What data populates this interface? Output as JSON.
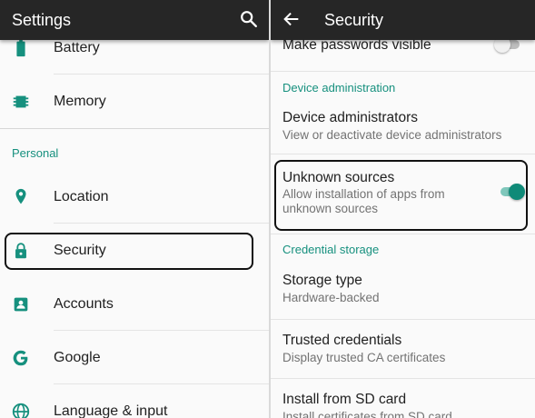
{
  "colors": {
    "accent": "#16907e",
    "appbar": "#262626",
    "toggle_on_thumb": "#0f8a78",
    "toggle_on_track": "#7fc7bb"
  },
  "left": {
    "title": "Settings",
    "search_icon": "search-icon",
    "items_top": [
      {
        "label": "Battery",
        "icon": "battery-icon"
      },
      {
        "label": "Memory",
        "icon": "memory-icon"
      }
    ],
    "section_personal": "Personal",
    "items_personal": [
      {
        "label": "Location",
        "icon": "location-icon"
      },
      {
        "label": "Security",
        "icon": "lock-icon"
      },
      {
        "label": "Accounts",
        "icon": "account-icon"
      },
      {
        "label": "Google",
        "icon": "google-icon"
      },
      {
        "label": "Language & input",
        "icon": "globe-icon"
      }
    ]
  },
  "right": {
    "title": "Security",
    "back_icon": "back-arrow-icon",
    "make_passwords": {
      "title": "Make passwords visible",
      "enabled": false
    },
    "section_device_admin": "Device administration",
    "device_admins": {
      "title": "Device administrators",
      "summary": "View or deactivate device administrators"
    },
    "unknown_sources": {
      "title": "Unknown sources",
      "summary": "Allow installation of apps from unknown sources",
      "enabled": true
    },
    "section_credential": "Credential storage",
    "storage_type": {
      "title": "Storage type",
      "summary": "Hardware-backed"
    },
    "trusted_credentials": {
      "title": "Trusted credentials",
      "summary": "Display trusted CA certificates"
    },
    "install_sd": {
      "title": "Install from SD card",
      "summary": "Install certificates from SD card"
    }
  }
}
